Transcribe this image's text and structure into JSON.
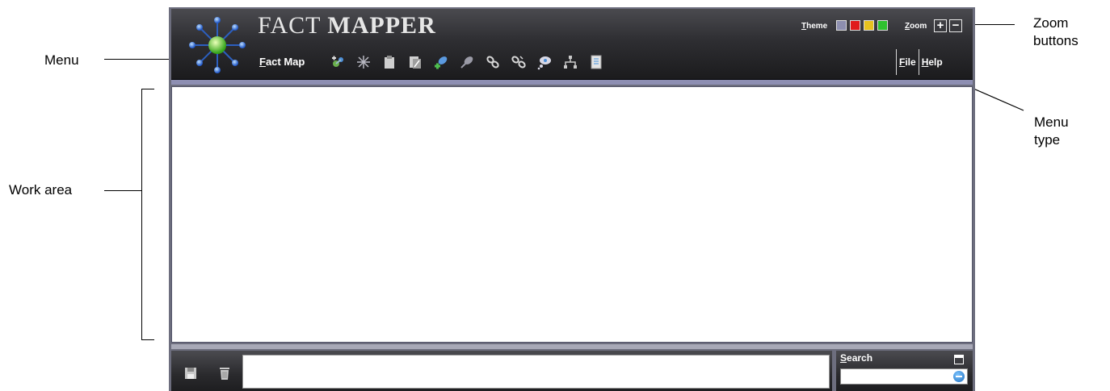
{
  "app": {
    "title_light": "FACT",
    "title_bold": "MAPPER",
    "menu_label": "Fact Map",
    "menu_label_access": "F",
    "menu_label_rest": "act Map"
  },
  "theme": {
    "label_access": "T",
    "label_rest": "heme",
    "swatches": [
      "#8d8fb0",
      "#e01b1b",
      "#e6c21f",
      "#2fc22f"
    ]
  },
  "zoom": {
    "label_access": "Z",
    "label_rest": "oom",
    "plus": "+",
    "minus": "−"
  },
  "menu_type": {
    "file_access": "F",
    "file_rest": "ile",
    "help_access": "H",
    "help_rest": "elp"
  },
  "toolbar": {
    "icons": [
      "add-fact-icon",
      "sparkle-icon",
      "clipboard-icon",
      "document-icon",
      "add-link-icon",
      "remove-link-icon",
      "chain-icon",
      "broken-chain-icon",
      "thought-icon",
      "hierarchy-icon",
      "properties-icon"
    ]
  },
  "search": {
    "label_access": "S",
    "label_rest": "earch",
    "value": ""
  },
  "annotations": {
    "menu": "Menu",
    "work_area": "Work area",
    "zoom_buttons_1": "Zoom",
    "zoom_buttons_2": "buttons",
    "menu_type_1": "Menu",
    "menu_type_2": "type"
  }
}
